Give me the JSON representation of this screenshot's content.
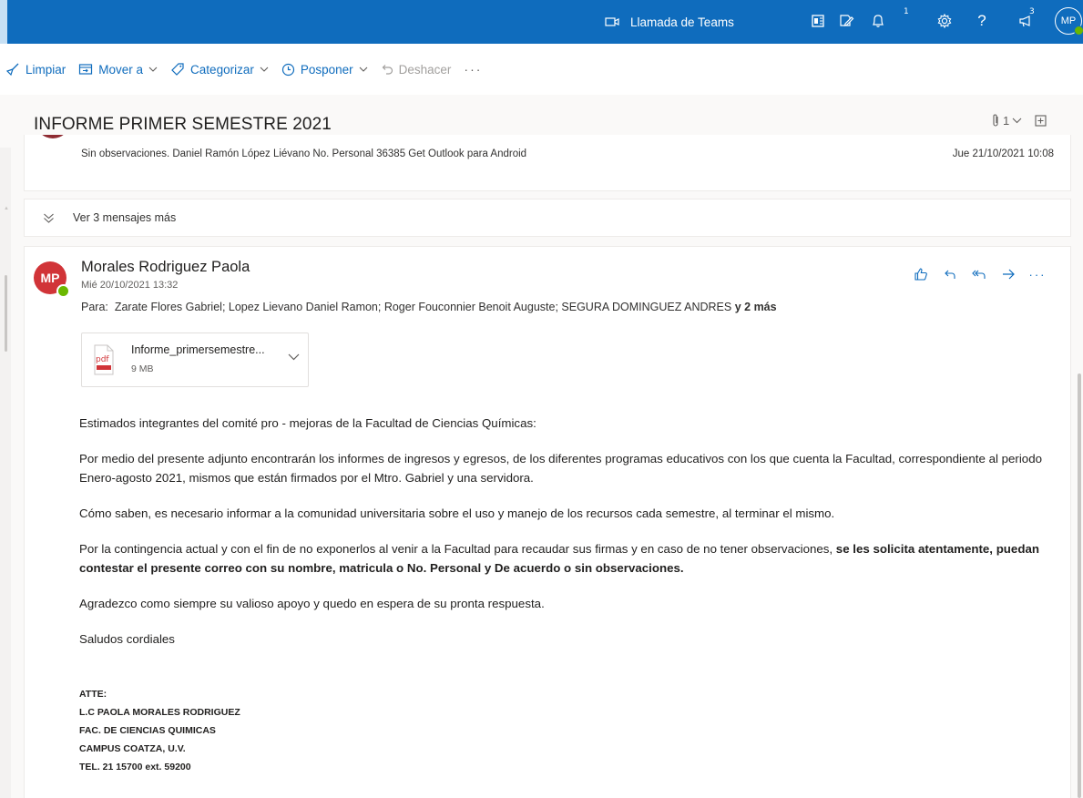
{
  "topbar": {
    "teams_call_label": "Llamada de Teams",
    "notifications_badge": "1",
    "whatsnew_badge": "3",
    "user_initials": "MP",
    "icons": [
      "teams-call-icon",
      "office-apps-icon",
      "edit-note-icon",
      "bell-icon",
      "gear-icon",
      "help-icon",
      "megaphone-icon"
    ]
  },
  "commandbar": {
    "sweep": "Limpiar",
    "move_to": "Mover a",
    "categorize": "Categorizar",
    "snooze": "Posponer",
    "undo": "Deshacer",
    "more": "···"
  },
  "thread": {
    "subject": "INFORME PRIMER SEMESTRE 2021",
    "attachment_count": "1",
    "collapsed_message": {
      "preview": "Sin observaciones. Daniel Ramón López Liévano No. Personal 36385 Get Outlook para Android",
      "date": "Jue 21/10/2021 10:08"
    },
    "more_messages_label": "Ver 3 mensajes más"
  },
  "message": {
    "avatar_initials": "MP",
    "sender": "Morales Rodriguez Paola",
    "date": "Mié 20/10/2021 13:32",
    "to_prefix": "Para:",
    "recipients": "Zarate Flores Gabriel; Lopez Lievano Daniel Ramon; Roger Fouconnier Benoit Auguste; SEGURA DOMINGUEZ ANDRES",
    "recipients_more": "y 2 más",
    "more_actions": "···",
    "attachment": {
      "name": "Informe_primersemestre...",
      "size": "9 MB",
      "type_label": "pdf"
    },
    "body": {
      "p1": "Estimados integrantes del comité pro - mejoras de la Facultad de Ciencias Químicas:",
      "p2": "Por medio del presente adjunto encontrarán los informes de ingresos y egresos, de los diferentes programas educativos con los que cuenta la Facultad, correspondiente al periodo Enero-agosto 2021, mismos que están firmados por el Mtro. Gabriel y una servidora.",
      "p3": "Cómo saben, es necesario informar a la comunidad universitaria sobre el uso y manejo de los recursos cada semestre, al terminar el mismo.",
      "p4_normal": "Por la contingencia actual y con el fin de no exponerlos al venir a la Facultad para recaudar sus firmas y en caso de no tener observaciones, ",
      "p4_bold": "se les solicita atentamente, puedan contestar el presente correo con su nombre, matricula o No. Personal y De acuerdo o sin observaciones.",
      "p5": "Agradezco como siempre su valioso apoyo y quedo en espera de su pronta respuesta.",
      "p6": "Saludos cordiales"
    },
    "signature": {
      "line1": "ATTE:",
      "line2": "L.C PAOLA MORALES RODRIGUEZ",
      "line3": "FAC. DE CIENCIAS QUIMICAS",
      "line4": "CAMPUS COATZA, U.V.",
      "line5": "TEL. 21 15700 ext. 59200"
    }
  },
  "colors": {
    "brand_blue": "#0f6cbd",
    "avatar_red": "#d13438",
    "collapsed_avatar": "#8e2b32",
    "presence_green": "#6bb700"
  }
}
